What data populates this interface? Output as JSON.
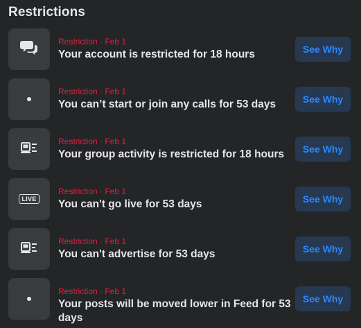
{
  "section": {
    "title": "Restrictions"
  },
  "restrictions": [
    {
      "icon": "chat-bubbles-icon",
      "meta": "Restriction · Feb 1",
      "text": "Your account is restricted for 18 hours",
      "button": "See Why"
    },
    {
      "icon": "dot-icon",
      "meta": "Restriction · Feb 1",
      "text": "You can’t start or join any calls for 53 days",
      "button": "See Why"
    },
    {
      "icon": "group-feed-icon",
      "meta": "Restriction · Feb 1",
      "text": "Your group activity is restricted for 18 hours",
      "button": "See Why"
    },
    {
      "icon": "live-icon",
      "icon_text": "LIVE",
      "meta": "Restriction · Feb 1",
      "text": "You can't go live for 53 days",
      "button": "See Why"
    },
    {
      "icon": "group-feed-icon",
      "meta": "Restriction · Feb 1",
      "text": "You can't advertise for 53 days",
      "button": "See Why"
    },
    {
      "icon": "dot-icon",
      "meta": "Restriction · Feb 1",
      "text": "Your posts will be moved lower in Feed for 53 days",
      "button": "See Why"
    }
  ],
  "colors": {
    "background": "#242526",
    "icon_box": "#3a3b3c",
    "meta_red": "#e41e3f",
    "button_bg": "#263951",
    "button_text": "#2d88ff"
  }
}
